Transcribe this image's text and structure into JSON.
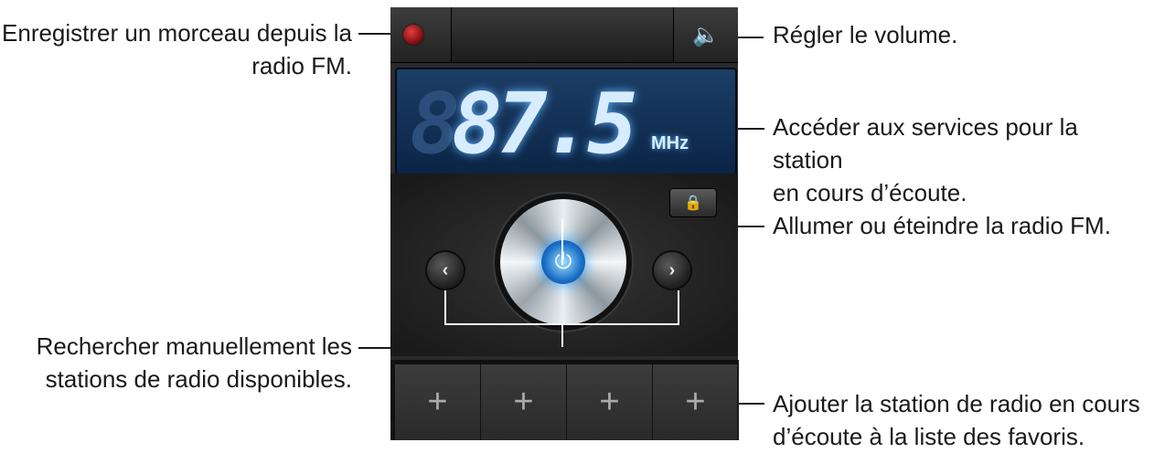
{
  "callouts": {
    "record": "Enregistrer un morceau depuis la\nradio FM.",
    "volume": "Régler le volume.",
    "services": "Accéder aux services pour la station\nen cours d’écoute.",
    "power": "Allumer ou éteindre la radio FM.",
    "search": "Rechercher manuellement les\nstations de radio disponibles.",
    "favorites": "Ajouter la station de radio en cours\nd’écoute à la liste des favoris."
  },
  "radio": {
    "frequency": "87.5",
    "unit": "MHz",
    "ghost_digit": "8",
    "prev_symbol": "‹",
    "next_symbol": "›",
    "favorites": [
      "+",
      "+",
      "+",
      "+"
    ]
  },
  "icons": {
    "record": "record-icon",
    "volume": "speaker-icon",
    "services": "lock-icon",
    "power": "power-icon"
  },
  "colors": {
    "display_glow": "#5fb3ff",
    "power_glow": "#3ca6ff",
    "record_red": "#e04040"
  }
}
